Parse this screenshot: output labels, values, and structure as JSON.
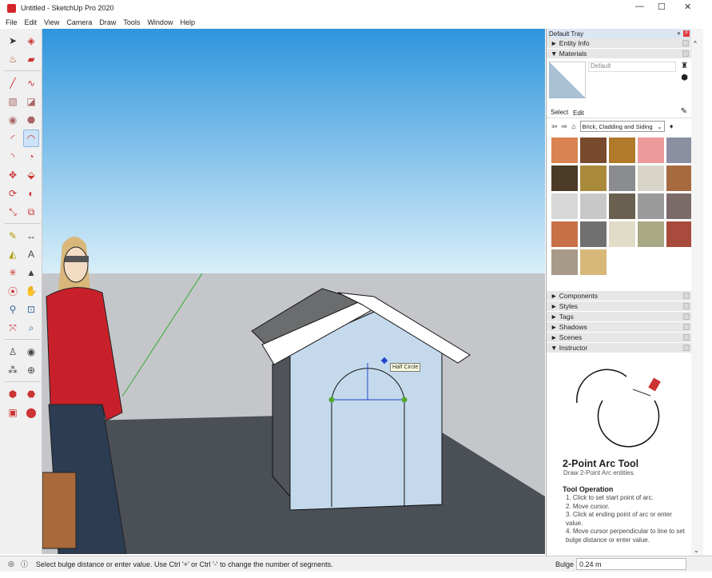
{
  "window": {
    "title": "Untitled - SketchUp Pro 2020",
    "minimize": "—",
    "maximize": "☐",
    "close": "✕"
  },
  "menu": [
    "File",
    "Edit",
    "View",
    "Camera",
    "Draw",
    "Tools",
    "Window",
    "Help"
  ],
  "toolbar": {
    "tools": [
      "select",
      "make-component",
      "paint-bucket",
      "eraser",
      "line",
      "freehand",
      "rectangle",
      "rotated-rectangle",
      "circle",
      "polygon",
      "arc",
      "2-point-arc",
      "3-point-arc",
      "pie",
      "move",
      "push-pull",
      "rotate",
      "follow-me",
      "scale",
      "offset",
      "tape-measure",
      "dimension",
      "protractor",
      "text",
      "axes",
      "3d-text",
      "orbit",
      "pan",
      "zoom",
      "zoom-window",
      "zoom-extents",
      "previous",
      "position-camera",
      "look-around",
      "walk",
      "section-plane",
      "warehouse",
      "extension-warehouse",
      "layout",
      "extension-manager"
    ],
    "active": "2-point-arc"
  },
  "viewport": {
    "tooltip": "Half Circle",
    "colors": {
      "sky_top": "#2f95dd",
      "sky_bottom": "#d8eef8",
      "ground": "#c5c6ca",
      "dark_ground": "#4b4f56",
      "wall": "#c4d9ec",
      "roof": "#6a6c6e"
    }
  },
  "tray": {
    "title": "Default Tray",
    "pin": "ᵠ",
    "close": "x",
    "panels_top": [
      {
        "label": "Entity Info",
        "arrow": "►"
      },
      {
        "label": "Materials",
        "arrow": "▼"
      }
    ],
    "materials": {
      "name": "Default",
      "tabs": [
        "Select",
        "Edit"
      ],
      "library": "Brick, Cladding and Siding",
      "swatches": [
        "#d98350",
        "#7a4a2e",
        "#b07a2a",
        "#ee9a9a",
        "#8a8fa2",
        "#4a3a26",
        "#a88a3a",
        "#8a8c90",
        "#d8d4c8",
        "#a66a40",
        "#d8d8d8",
        "#c8c8c8",
        "#6a6050",
        "#9a9a9a",
        "#7a6a68",
        "#c87048",
        "#707070",
        "#e0dcc8",
        "#a8a884",
        "#a84a3c",
        "#a89a88",
        "#d8b878"
      ]
    },
    "panels": [
      {
        "label": "Components",
        "arrow": "►"
      },
      {
        "label": "Styles",
        "arrow": "►"
      },
      {
        "label": "Tags",
        "arrow": "►"
      },
      {
        "label": "Shadows",
        "arrow": "►"
      },
      {
        "label": "Scenes",
        "arrow": "►"
      },
      {
        "label": "Instructor",
        "arrow": "▼"
      }
    ],
    "instructor": {
      "title": "2-Point Arc Tool",
      "subtitle": "Draw 2-Point Arc entities.",
      "section": "Tool Operation",
      "steps": [
        "1. Click to set start point of arc.",
        "2. Move cursor.",
        "3. Click at ending point of arc or enter value.",
        "4. Move cursor perpendicular to line to set bulge distance or enter value."
      ]
    }
  },
  "status": {
    "message": "Select bulge distance or enter value. Use Ctrl '+' or Ctrl '-' to change the number of segments.",
    "vcb_label": "Bulge",
    "vcb_value": "0.24 m"
  }
}
